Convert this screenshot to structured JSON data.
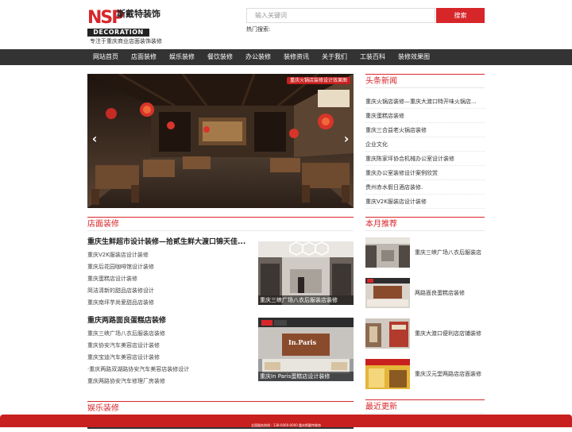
{
  "logo": {
    "mark": "NSP",
    "brand_cn": "斯戴特装饰",
    "brand_en": "DECORATION",
    "slogan": "专注于重庆商业店面装饰装修"
  },
  "search": {
    "placeholder": "输入关键词",
    "button_label": "搜索",
    "hot_label": "热门搜索:"
  },
  "nav": {
    "items": [
      {
        "label": "网站首页"
      },
      {
        "label": "店面装修"
      },
      {
        "label": "娱乐装修"
      },
      {
        "label": "餐饮装修"
      },
      {
        "label": "办公装修"
      },
      {
        "label": "装修资讯"
      },
      {
        "label": "关于我们"
      },
      {
        "label": "工装百科"
      },
      {
        "label": "装修效果图"
      }
    ]
  },
  "banner": {
    "caption": "重庆火锅店装修设计效果图",
    "prev": "‹",
    "next": "›"
  },
  "headline_news": {
    "title": "头条新闻",
    "items": [
      "重庆火锅店装修—重庆大渡口特开味火锅店...",
      "重庆蛋糕店装修",
      "重庆三合益老火锅店装修",
      "企业文化",
      "重庆陈家坪协合机械办公室设计装修",
      "重庆办公室装修设计案例欣赏",
      "贵州赤水假日酒店装修.",
      "重庆V2K服装店设计装修"
    ]
  },
  "store_section": {
    "title": "店面装修",
    "block1": {
      "heading": "重庆生鲜超市设计装修—拾贰生鲜大渡口锦天佳...",
      "items": [
        "重庆V2K服装店设计装修",
        "重庆后花园咖啡馆设计装修",
        "重庆蛋糕店设计装修",
        "简洁清新的甜品店装修设计",
        "重庆南坪芋尚爱甜品店装修"
      ],
      "thumb_caption": "重庆三峡广场八衣后服装店装修"
    },
    "block2": {
      "heading": "重庆两路面良蛋糕店装修",
      "items": [
        "重庆三峡广场八衣后服装店装修",
        "重庆协安汽车美容店设计装修",
        "重庆宝迪汽车美容店设计装修",
        "·重庆两路双湖路协安汽车美容店装修设计",
        "重庆两路协安汽车修理厂房装修"
      ],
      "thumb_caption": "重庆In Paris蛋糕店设计装修",
      "thumb_sign": "In.Paris"
    }
  },
  "month_recommend": {
    "title": "本月推荐",
    "items": [
      "重庆三峡广场八衣后服装店",
      "两路面良蛋糕店装修",
      "重庆大渡口便利店店铺装修",
      "重庆汉元堂两路店店面装修"
    ]
  },
  "entertainment_section": {
    "title": "娱乐装修"
  },
  "latest_updates": {
    "title": "最近更新"
  },
  "bottom_bar": {
    "text": "全国服务热线 : 138-0000-0000 重庆斯戴特装饰"
  }
}
